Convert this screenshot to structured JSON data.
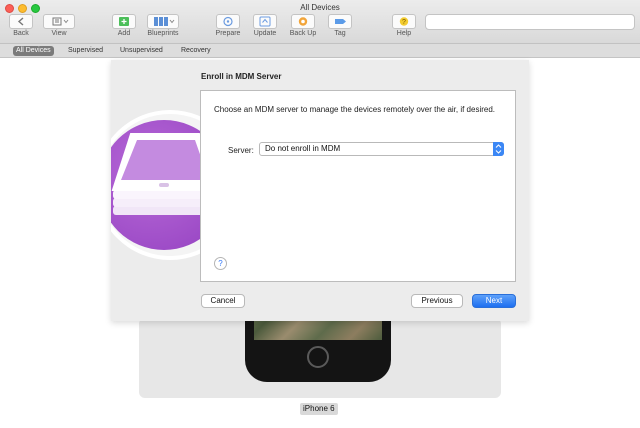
{
  "window": {
    "title": "All Devices"
  },
  "toolbar": {
    "back": "Back",
    "view": "View",
    "add": "Add",
    "blueprints": "Blueprints",
    "prepare": "Prepare",
    "update": "Update",
    "backup": "Back Up",
    "tag": "Tag",
    "help": "Help"
  },
  "tabs": [
    "All Devices",
    "Supervised",
    "Unsupervised",
    "Recovery"
  ],
  "sheet": {
    "title": "Enroll in MDM Server",
    "description": "Choose an MDM server to manage the devices remotely over the air, if desired.",
    "server_label": "Server:",
    "server_value": "Do not enroll in MDM",
    "help_glyph": "?",
    "cancel": "Cancel",
    "previous": "Previous",
    "next": "Next"
  },
  "device": {
    "name": "iPhone 6"
  },
  "colors": {
    "accent": "#3478f6",
    "badge": "#a452cf",
    "active_tab": "#7b7b7b"
  }
}
